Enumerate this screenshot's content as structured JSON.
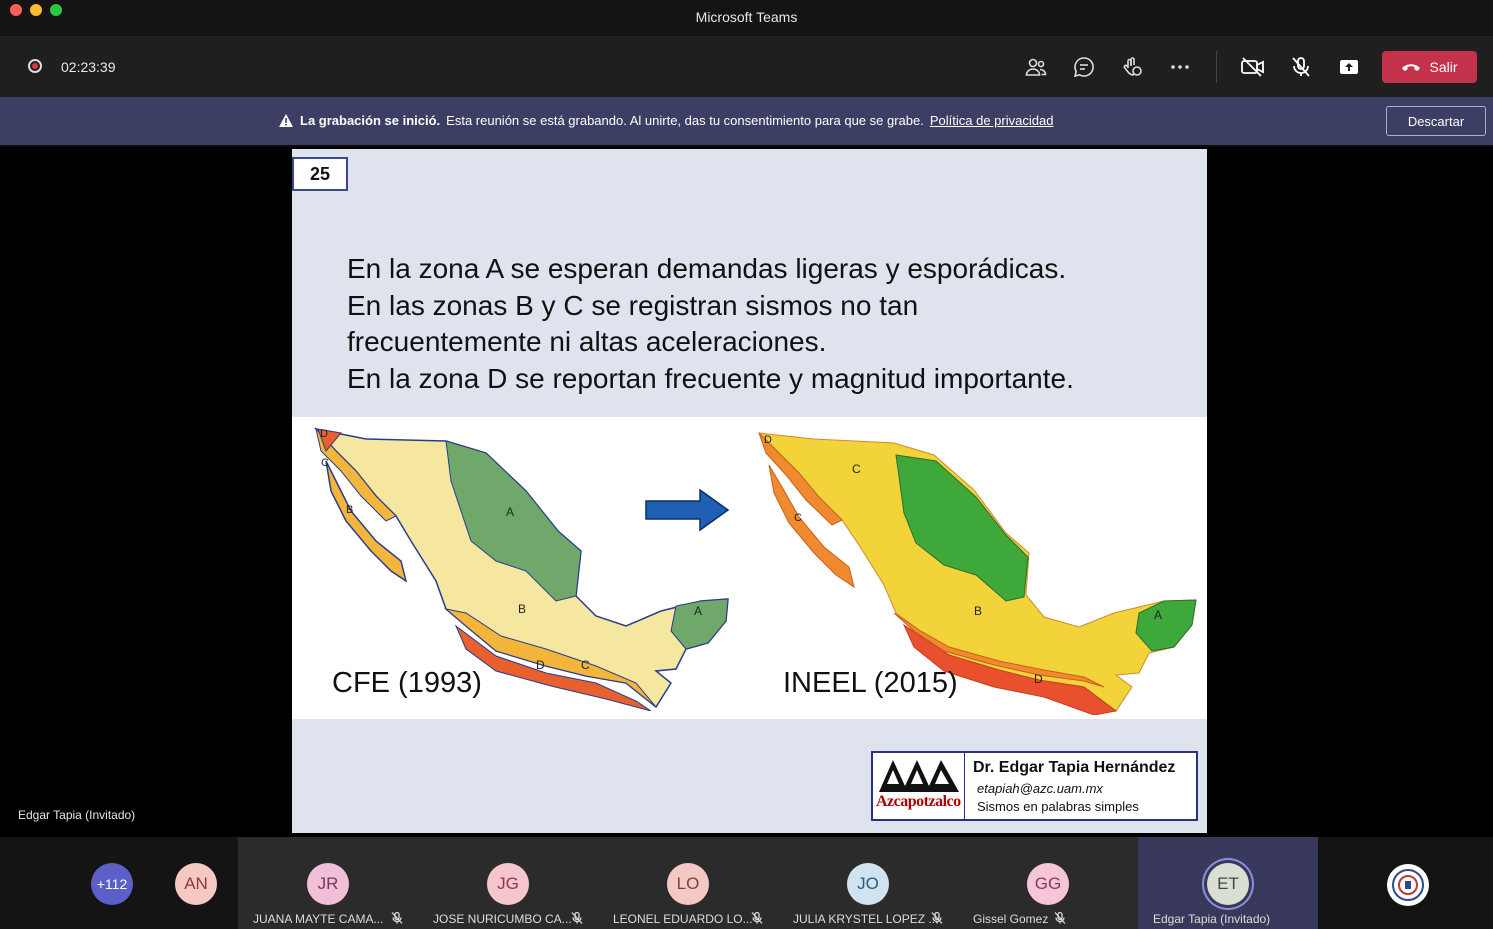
{
  "window": {
    "title": "Microsoft Teams"
  },
  "topbar": {
    "timer": "02:23:39",
    "leave_label": "Salir",
    "icons": [
      "participants-icon",
      "chat-icon",
      "reactions-icon",
      "more-icon",
      "camera-off-icon",
      "mic-off-icon",
      "share-icon"
    ]
  },
  "banner": {
    "bold": "La grabación se inició.",
    "text": "Esta reunión se está grabando. Al unirte, das tu consentimiento para que se grabe.",
    "link": "Política de privacidad",
    "dismiss": "Descartar"
  },
  "slide": {
    "number": "25",
    "lines": [
      "En la zona A se esperan demandas ligeras y esporádicas.",
      "En las zonas B y C se registran sismos no tan",
      "frecuentemente ni altas aceleraciones.",
      "En la zona D se reportan frecuente y magnitud importante."
    ],
    "map_left_label": "CFE (1993)",
    "map_right_label": "INEEL (2015)",
    "logo_text": "Azcapotzalco",
    "author": "Dr. Edgar Tapia Hernández",
    "email": "etapiah@azc.uam.mx",
    "tagline": "Sismos en palabras simples",
    "colors": {
      "zone_a": "#6fa86a",
      "zone_b": "#f5e6a0",
      "zone_c": "#f3b53a",
      "zone_d": "#e8602e",
      "arrow": "#1f5fb4"
    }
  },
  "presenter_name": "Edgar Tapia (Invitado)",
  "gallery": {
    "overflow": {
      "label": "+112",
      "color": "#5b5fc7"
    },
    "first": {
      "initials": "AN",
      "color": "#f6c8c2"
    },
    "tiles": [
      {
        "initials": "JR",
        "name": "JUANA MAYTE CAMA...",
        "color": "#f1c0d8"
      },
      {
        "initials": "JG",
        "name": "JOSE NURICUMBO CA...",
        "color": "#f6c5cd"
      },
      {
        "initials": "LO",
        "name": "LEONEL EDUARDO LO...",
        "color": "#f2c9c4"
      },
      {
        "initials": "JO",
        "name": "JULIA KRYSTEL LOPEZ ...",
        "color": "#cfe3f0"
      },
      {
        "initials": "GG",
        "name": "Gissel Gomez",
        "color": "#f6c6d8"
      },
      {
        "initials": "ET",
        "name": "Edgar Tapia (Invitado)",
        "color": "#d9dfd2"
      }
    ]
  }
}
